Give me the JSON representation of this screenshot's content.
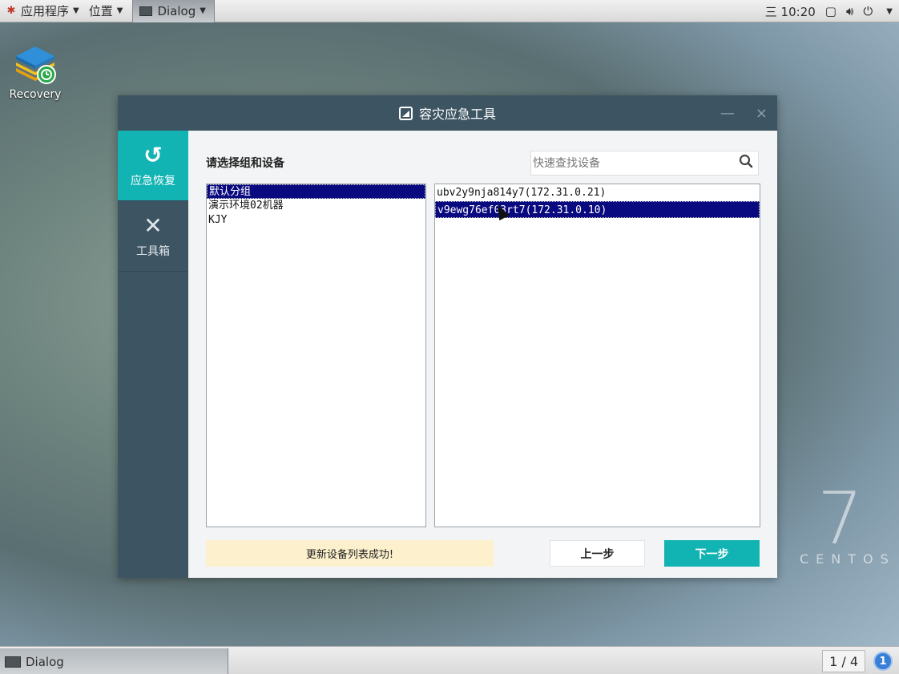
{
  "top_panel": {
    "apps_label": "应用程序",
    "places_label": "位置",
    "active_window_label": "Dialog",
    "clock": "三 10:20"
  },
  "desktop": {
    "icon_label": "Recovery",
    "centos_numeral": "7",
    "centos_word": "CENTOS"
  },
  "dialog": {
    "title": "容灾应急工具",
    "minimize_glyph": "—",
    "close_glyph": "×",
    "sidebar": {
      "items": [
        {
          "label": "应急恢复",
          "icon": "restore-icon",
          "glyph": "↺",
          "active": true
        },
        {
          "label": "工具箱",
          "icon": "tools-icon",
          "glyph": "✕",
          "active": false
        }
      ]
    },
    "heading": "请选择组和设备",
    "search": {
      "placeholder": "快速查找设备",
      "value": ""
    },
    "groups": [
      {
        "label": "默认分组",
        "selected": true
      },
      {
        "label": "演示环境02机器",
        "selected": false
      },
      {
        "label": "KJY",
        "selected": false
      }
    ],
    "devices": [
      {
        "label": "ubv2y9nja814y7(172.31.0.21)",
        "selected": false
      },
      {
        "label": "v9ewg76ef03rt7(172.31.0.10)",
        "selected": true
      }
    ],
    "status_message": "更新设备列表成功!",
    "prev_button": "上一步",
    "next_button": "下一步"
  },
  "bottom_panel": {
    "task_label": "Dialog",
    "workspace": "1 / 4",
    "notification_count": "1"
  },
  "colors": {
    "accent": "#12b3b3",
    "dialog_chrome": "#3d5462",
    "selection": "#0a0a80",
    "status_bg": "#fdf1cd"
  }
}
